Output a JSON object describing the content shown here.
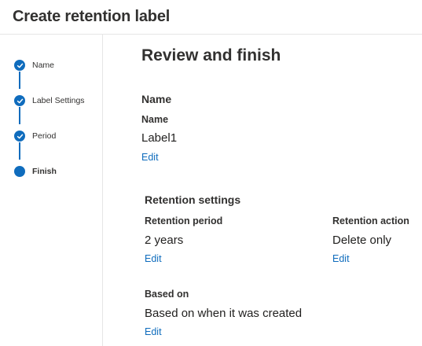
{
  "header": {
    "title": "Create retention label"
  },
  "steps": [
    {
      "label": "Name",
      "state": "completed",
      "icon": "check-icon"
    },
    {
      "label": "Label Settings",
      "state": "completed",
      "icon": "check-icon"
    },
    {
      "label": "Period",
      "state": "completed",
      "icon": "check-icon"
    },
    {
      "label": "Finish",
      "state": "current"
    }
  ],
  "main": {
    "title": "Review and finish",
    "name_section": {
      "title": "Name",
      "name_label": "Name",
      "name_value": "Label1",
      "edit": "Edit"
    },
    "retention_section": {
      "title": "Retention settings",
      "period_label": "Retention period",
      "period_value": "2 years",
      "period_edit": "Edit",
      "action_label": "Retention action",
      "action_value": "Delete only",
      "action_edit": "Edit",
      "based_on_label": "Based on",
      "based_on_value": "Based on when it was created",
      "based_on_edit": "Edit"
    }
  },
  "colors": {
    "accent": "#0f6cbd",
    "text": "#323130",
    "divider": "#e6e6e6"
  }
}
